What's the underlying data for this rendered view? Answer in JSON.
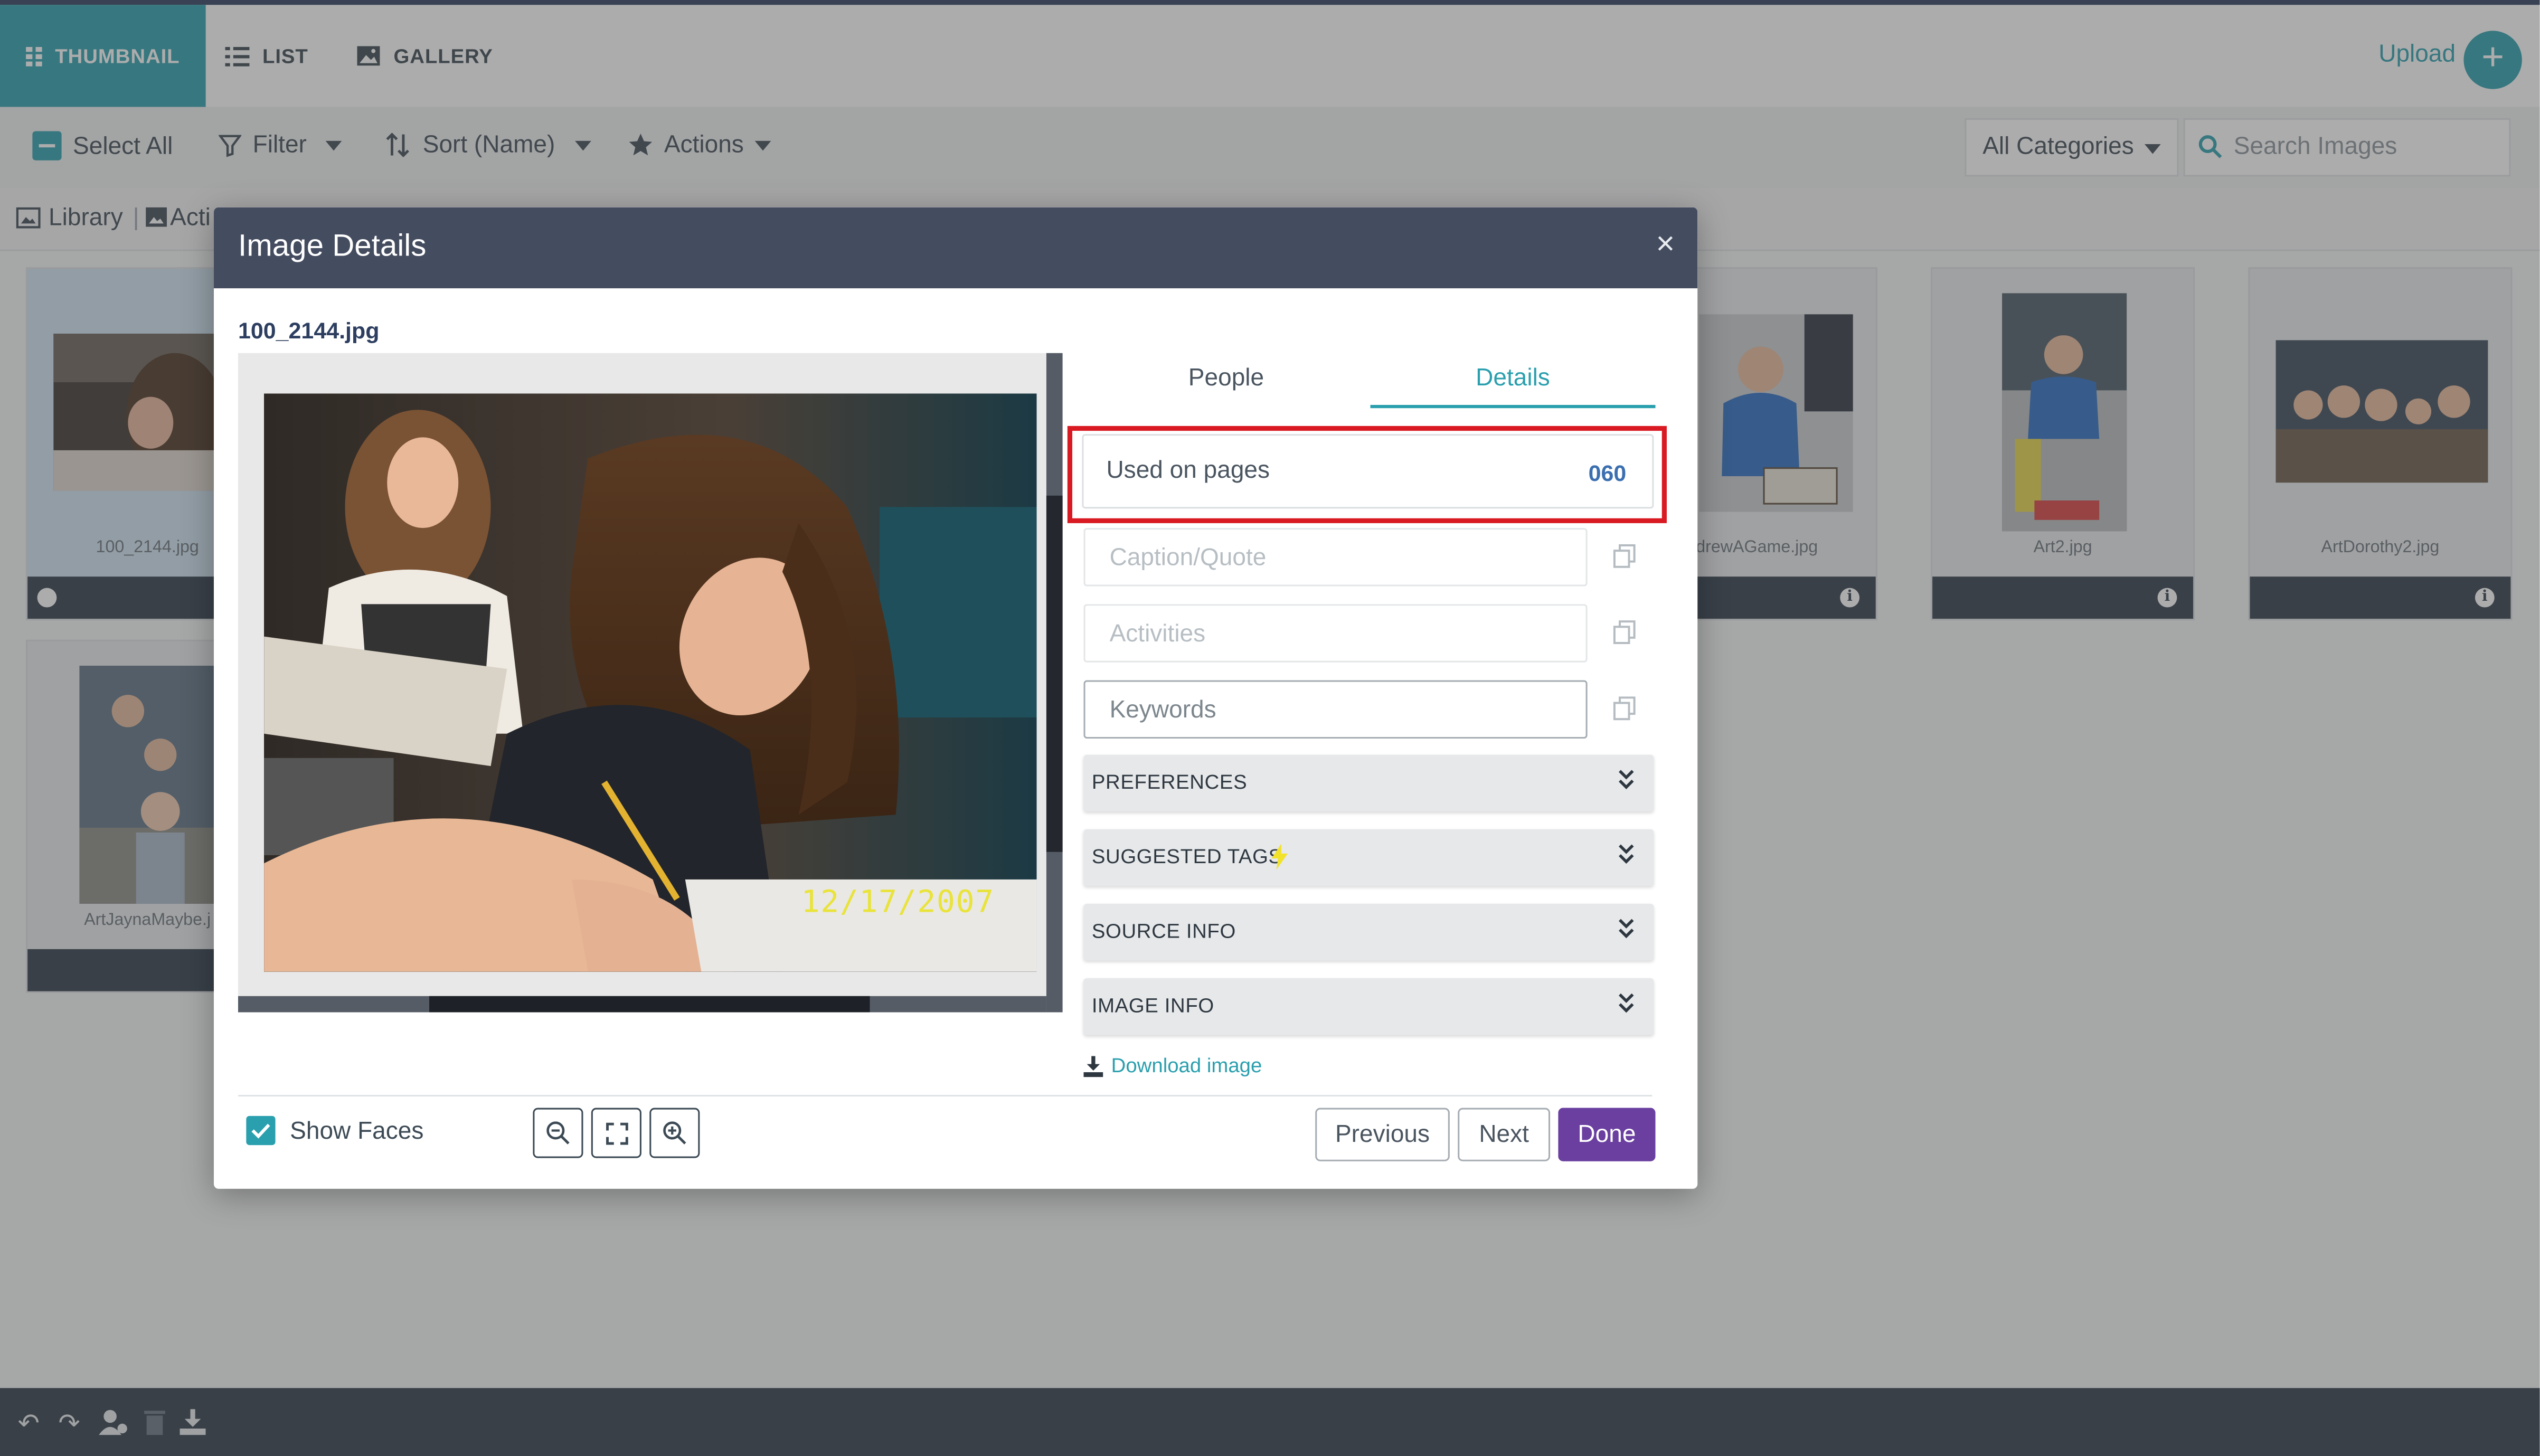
{
  "topbar": {
    "view_tabs": [
      "THUMBNAIL",
      "LIST",
      "GALLERY"
    ],
    "upload_label": "Upload"
  },
  "toolbar": {
    "select_all": "Select All",
    "filter": "Filter",
    "sort": "Sort (Name)",
    "actions": "Actions",
    "categories": "All Categories",
    "search_placeholder": "Search Images"
  },
  "crumbs": {
    "library": "Library",
    "activity": "Acti"
  },
  "thumbnails": [
    {
      "caption": "100_2144.jpg"
    },
    {
      "caption": "ArtJaynaMaybe.j"
    },
    {
      "caption": "drewAGame.jpg"
    },
    {
      "caption": "Art2.jpg"
    },
    {
      "caption": "ArtDorothy2.jpg"
    }
  ],
  "modal": {
    "title": "Image Details",
    "close": "×",
    "filename": "100_2144.jpg",
    "photo_date_stamp": "12/17/2007",
    "tabs": {
      "people": "People",
      "details": "Details"
    },
    "active_tab": "Details",
    "used_on_pages": {
      "label": "Used on pages",
      "value": "060"
    },
    "fields": {
      "caption_placeholder": "Caption/Quote",
      "activities_placeholder": "Activities",
      "keywords_placeholder": "Keywords"
    },
    "sections": [
      "PREFERENCES",
      "SUGGESTED TAGS",
      "SOURCE INFO",
      "IMAGE INFO"
    ],
    "download_label": "Download image",
    "show_faces_label": "Show Faces",
    "show_faces_checked": true,
    "buttons": {
      "previous": "Previous",
      "next": "Next",
      "done": "Done"
    }
  },
  "colors": {
    "accent": "#2a9fae",
    "header": "#444c5f",
    "done": "#6a3fa0",
    "highlight": "#d91a22"
  }
}
